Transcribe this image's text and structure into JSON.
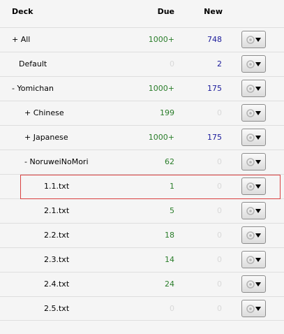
{
  "header": {
    "deck": "Deck",
    "due": "Due",
    "new": "New"
  },
  "rows": [
    {
      "name": "+ All",
      "indent": 17,
      "due": "1000+",
      "new": "748",
      "due_zero": false,
      "new_zero": false
    },
    {
      "name": "Default",
      "indent": 27,
      "due": "0",
      "new": "2",
      "due_zero": true,
      "new_zero": false
    },
    {
      "name": "-  Yomichan",
      "indent": 17,
      "due": "1000+",
      "new": "175",
      "due_zero": false,
      "new_zero": false
    },
    {
      "name": "+ Chinese",
      "indent": 35,
      "due": "199",
      "new": "0",
      "due_zero": false,
      "new_zero": true
    },
    {
      "name": "+ Japanese",
      "indent": 35,
      "due": "1000+",
      "new": "175",
      "due_zero": false,
      "new_zero": false
    },
    {
      "name": "-  NoruweiNoMori",
      "indent": 35,
      "due": "62",
      "new": "0",
      "due_zero": false,
      "new_zero": true
    },
    {
      "name": "1.1.txt",
      "indent": 63,
      "due": "1",
      "new": "0",
      "due_zero": false,
      "new_zero": true
    },
    {
      "name": "2.1.txt",
      "indent": 63,
      "due": "5",
      "new": "0",
      "due_zero": false,
      "new_zero": true
    },
    {
      "name": "2.2.txt",
      "indent": 63,
      "due": "18",
      "new": "0",
      "due_zero": false,
      "new_zero": true
    },
    {
      "name": "2.3.txt",
      "indent": 63,
      "due": "14",
      "new": "0",
      "due_zero": false,
      "new_zero": true
    },
    {
      "name": "2.4.txt",
      "indent": 63,
      "due": "24",
      "new": "0",
      "due_zero": false,
      "new_zero": true
    },
    {
      "name": "2.5.txt",
      "indent": 63,
      "due": "0",
      "new": "0",
      "due_zero": true,
      "new_zero": true
    }
  ],
  "icons": {
    "options": "gear-dropdown-icon"
  },
  "colors": {
    "due": "#2a7d2a",
    "new": "#1a1a9b",
    "zero": "#d9d9d9",
    "highlight": "#d94040"
  }
}
